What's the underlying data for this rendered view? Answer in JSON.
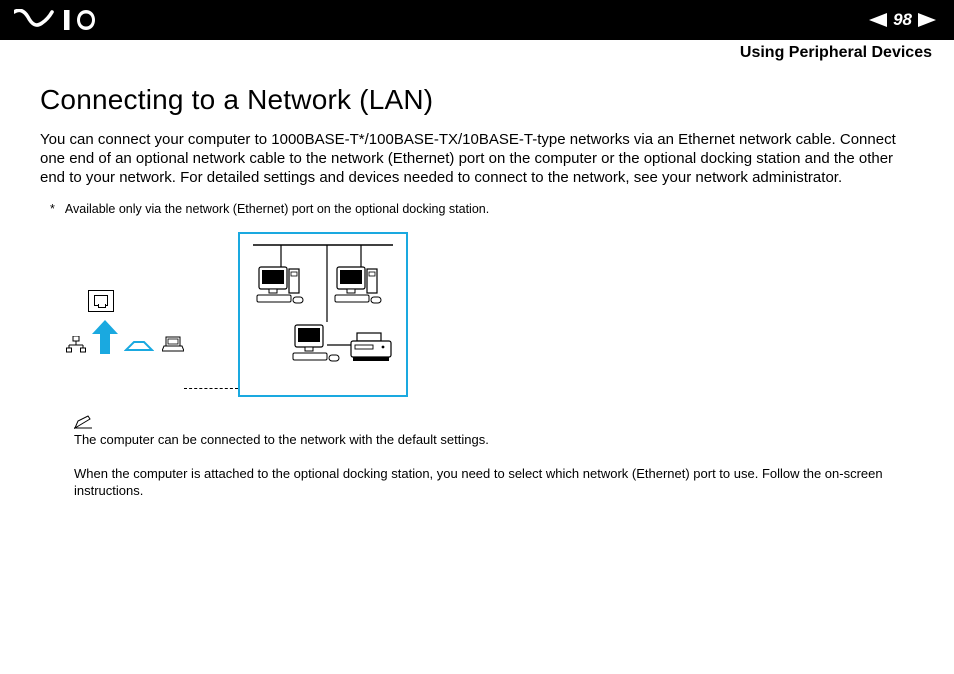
{
  "header": {
    "page_number": "98",
    "section": "Using Peripheral Devices"
  },
  "content": {
    "title": "Connecting to a Network (LAN)",
    "paragraph": "You can connect your computer to 1000BASE-T*/100BASE-TX/10BASE-T-type networks via an Ethernet network cable. Connect one end of an optional network cable to the network (Ethernet) port on the computer or the optional docking station and the other end to your network. For detailed settings and devices needed to connect to the network, see your network administrator.",
    "footnote_mark": "*",
    "footnote_text": "Available only via the network (Ethernet) port on the optional docking station.",
    "note1": "The computer can be connected to the network with the default settings.",
    "note2": "When the computer is attached to the optional docking station, you need to select which network (Ethernet) port to use. Follow the on-screen instructions."
  }
}
